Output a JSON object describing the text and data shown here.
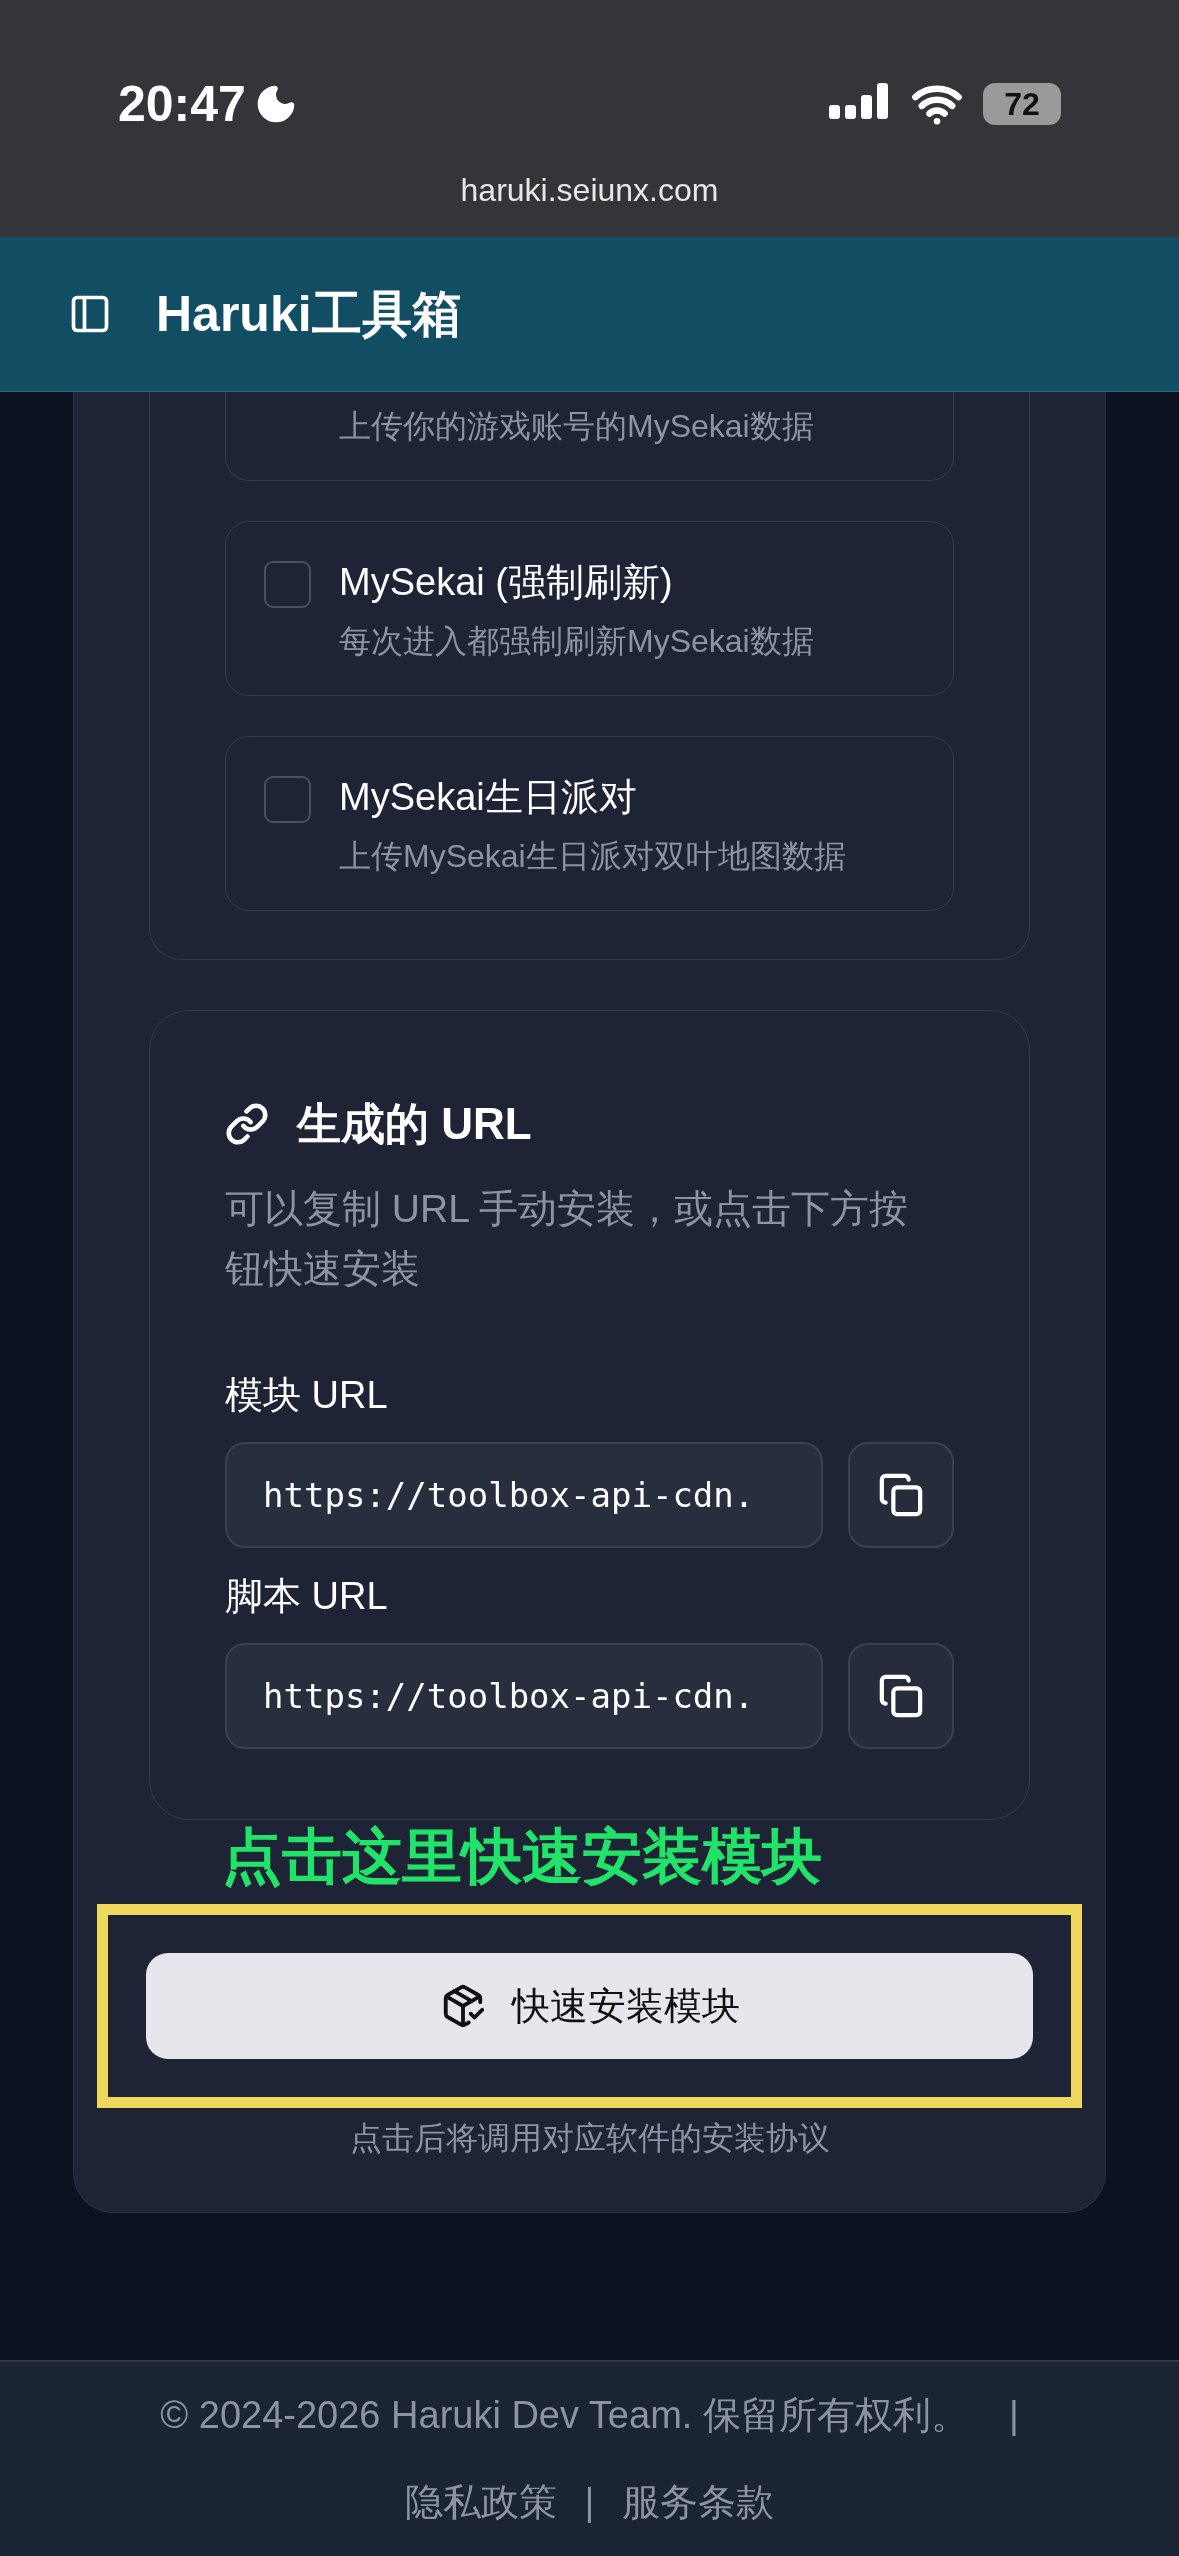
{
  "status_bar": {
    "time": "20:47",
    "battery": "72"
  },
  "browser": {
    "address": "haruki.seiunx.com"
  },
  "header": {
    "title": "Haruki工具箱"
  },
  "options": [
    {
      "description": "上传你的游戏账号的MySekai数据"
    },
    {
      "title": "MySekai (强制刷新)",
      "description": "每次进入都强制刷新MySekai数据",
      "checked": false
    },
    {
      "title": "MySekai生日派对",
      "description": "上传MySekai生日派对双叶地图数据",
      "checked": false
    }
  ],
  "url_section": {
    "title": "生成的 URL",
    "description": "可以复制 URL 手动安装，或点击下方按钮快速安装",
    "fields": [
      {
        "label": "模块 URL",
        "value": "https://toolbox-api-cdn."
      },
      {
        "label": "脚本 URL",
        "value": "https://toolbox-api-cdn."
      }
    ]
  },
  "annotation": {
    "text": "点击这里快速安装模块"
  },
  "install_button": {
    "label": "快速安装模块",
    "hint": "点击后将调用对应软件的安装协议"
  },
  "footer": {
    "copyright": "© 2024-2026 Haruki Dev Team. 保留所有权利。",
    "separator_1": "|",
    "privacy": "隐私政策",
    "separator_2": "|",
    "terms": "服务条款"
  }
}
